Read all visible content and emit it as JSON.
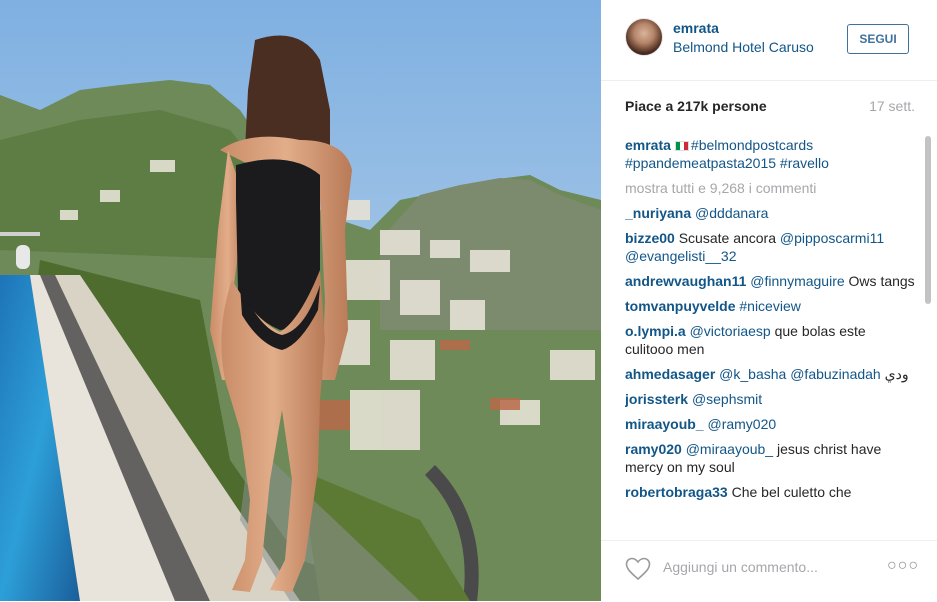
{
  "header": {
    "username": "emrata",
    "location": "Belmond Hotel Caruso",
    "follow_label": "SEGUI"
  },
  "stats": {
    "likes": "Piace a 217k persone",
    "time": "17 sett."
  },
  "caption": {
    "user": "emrata",
    "line1_tag": "#belmondpostcards",
    "line2": "#ppandemeatpasta2015 #ravello"
  },
  "more_comments": "mostra tutti e 9,268 i commenti",
  "comments": [
    {
      "user": "_nuriyana",
      "text": "@dddanara"
    },
    {
      "user": "bizze00",
      "text": "Scusate ancora @pipposcarmi11 @evangelisti__32"
    },
    {
      "user": "andrewvaughan11",
      "text": "@finnymaguire Ows tangs"
    },
    {
      "user": "tomvanpuyvelde",
      "text": "#niceview"
    },
    {
      "user": "o.lympi.a",
      "text": "@victoriaesp que bolas este culitooo men"
    },
    {
      "user": "ahmedasager",
      "text": "@k_basha @fabuzinadah ودي"
    },
    {
      "user": "jorissterk",
      "text": "@sephsmit"
    },
    {
      "user": "miraayoub_",
      "text": "@ramy020"
    },
    {
      "user": "ramy020",
      "text": "@miraayoub_ jesus christ have mercy on my soul"
    },
    {
      "user": "robertobraga33",
      "text": "Che bel culetto che"
    }
  ],
  "footer": {
    "comment_placeholder": "Aggiungi un commento...",
    "more_label": "○○○"
  },
  "icons": {
    "heart": "heart-icon",
    "more": "more-options-icon",
    "flag": "italy-flag-icon"
  },
  "colors": {
    "link": "#125688",
    "follow": "#3f729b",
    "muted": "#a5a7aa"
  }
}
